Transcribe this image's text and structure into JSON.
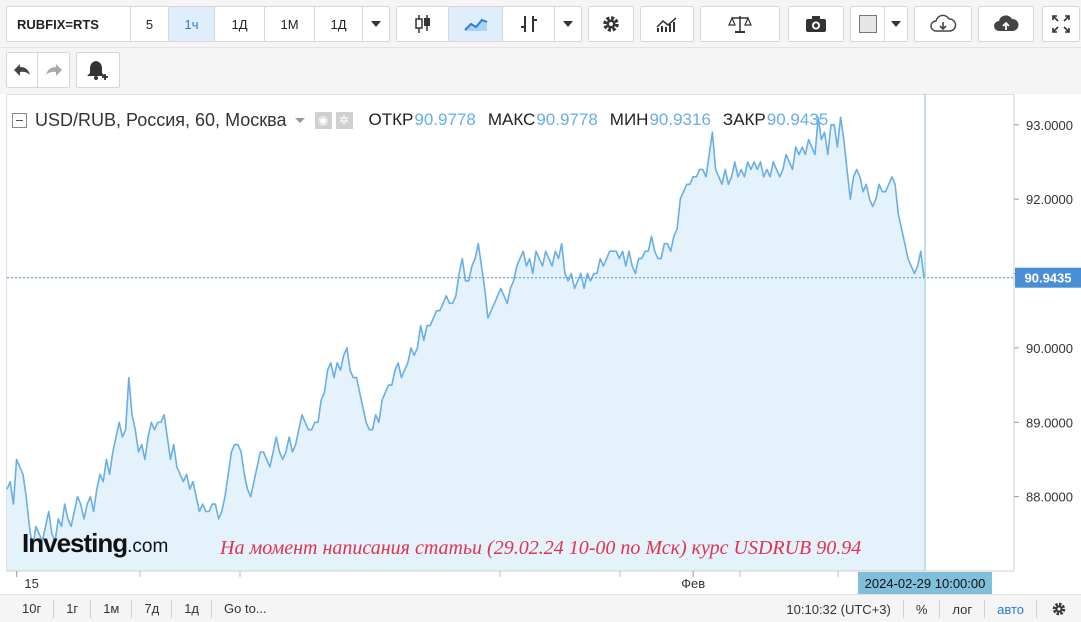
{
  "toolbar": {
    "symbol": "RUBFIX=RTS",
    "intervals": [
      "5",
      "1ч",
      "1Д",
      "1М",
      "1Д"
    ],
    "active_interval": 1
  },
  "legend": {
    "title": "USD/RUB, Россия, 60, Москва",
    "open_label": "ОТКР",
    "open_value": "90.9778",
    "high_label": "МАКС",
    "high_value": "90.9778",
    "low_label": "МИН",
    "low_value": "90.9316",
    "close_label": "ЗАКР",
    "close_value": "90.9435"
  },
  "logo": {
    "main": "Investing",
    "suffix": ".com"
  },
  "annotation": "На момент написания статьи (29.02.24 10-00 по Мск) курс USDRUB 90.94",
  "bottom": {
    "ranges": [
      "10г",
      "1г",
      "1м",
      "7д",
      "1д"
    ],
    "goto": "Go to...",
    "time": "10:10:32",
    "tz": "(UTC+3)",
    "percent": "%",
    "log": "лог",
    "auto": "авто"
  },
  "colors": {
    "line": "#6aaee6",
    "fill": "#e4f2fb",
    "price_tag": "#4a8fd6",
    "date_tag": "#7fbfd9",
    "annotation": "#e0334d"
  },
  "chart_data": {
    "type": "area",
    "title": "USD/RUB, Россия, 60, Москва",
    "xlabel": "",
    "ylabel": "",
    "ylim": [
      87.0,
      93.4
    ],
    "yticks": [
      88,
      89,
      90,
      91,
      92,
      93
    ],
    "ytick_labels": [
      "88.0000",
      "89.0000",
      "90.0000",
      "91.0000",
      "92.0000",
      "93.0000"
    ],
    "xtick_labels": [
      {
        "label": "15",
        "index": 3
      },
      {
        "label": "Фев",
        "index": 214
      }
    ],
    "last_value": 90.9435,
    "last_value_label": "90.9435",
    "last_date_label": "2024-02-29 10:00:00",
    "grid": false,
    "legend": "top-left",
    "series": [
      {
        "values": [
          88.1,
          88.2,
          87.9,
          88.5,
          88.4,
          88.3,
          88.0,
          87.6,
          87.3,
          87.6,
          87.5,
          87.4,
          87.6,
          87.8,
          87.5,
          87.4,
          87.7,
          87.6,
          87.9,
          87.7,
          87.6,
          87.8,
          88.0,
          87.9,
          87.7,
          87.9,
          88.0,
          87.8,
          88.1,
          88.3,
          88.2,
          88.5,
          88.3,
          88.6,
          88.8,
          89.0,
          88.8,
          88.9,
          89.6,
          89.1,
          88.9,
          88.6,
          88.7,
          88.5,
          88.8,
          89.0,
          88.9,
          89.0,
          89.0,
          89.1,
          88.8,
          88.5,
          88.7,
          88.4,
          88.3,
          88.2,
          88.3,
          88.1,
          88.2,
          88.0,
          87.8,
          87.9,
          87.8,
          87.8,
          87.9,
          87.9,
          87.7,
          87.8,
          88.0,
          88.3,
          88.6,
          88.7,
          88.7,
          88.6,
          88.3,
          88.1,
          88.0,
          88.2,
          88.4,
          88.6,
          88.6,
          88.5,
          88.4,
          88.6,
          88.8,
          88.6,
          88.5,
          88.6,
          88.8,
          88.6,
          88.7,
          88.9,
          89.1,
          89.0,
          88.9,
          88.9,
          89.0,
          89.0,
          89.3,
          89.4,
          89.7,
          89.8,
          89.6,
          89.8,
          89.7,
          89.9,
          90.0,
          89.7,
          89.6,
          89.6,
          89.4,
          89.2,
          89.0,
          88.9,
          88.9,
          89.1,
          89.0,
          89.3,
          89.4,
          89.5,
          89.5,
          89.7,
          89.8,
          89.6,
          89.7,
          89.8,
          90.0,
          89.9,
          90.0,
          90.3,
          90.1,
          90.3,
          90.3,
          90.4,
          90.5,
          90.5,
          90.6,
          90.7,
          90.6,
          90.6,
          90.7,
          91.0,
          91.2,
          90.9,
          90.9,
          91.1,
          91.2,
          91.4,
          91.1,
          90.8,
          90.4,
          90.5,
          90.6,
          90.7,
          90.8,
          90.7,
          90.6,
          90.8,
          90.9,
          91.1,
          91.2,
          91.3,
          91.1,
          91.2,
          91.0,
          91.3,
          91.2,
          91.1,
          91.3,
          91.2,
          91.1,
          91.3,
          91.2,
          91.4,
          91.0,
          90.9,
          91.0,
          90.8,
          90.9,
          91.0,
          90.8,
          91.0,
          90.9,
          91.0,
          91.0,
          91.2,
          91.1,
          91.2,
          91.3,
          91.3,
          91.3,
          91.2,
          91.3,
          91.1,
          91.3,
          91.1,
          91.0,
          91.2,
          91.2,
          91.3,
          91.3,
          91.5,
          91.3,
          91.2,
          91.2,
          91.4,
          91.4,
          91.3,
          91.5,
          91.6,
          92.0,
          92.1,
          92.2,
          92.2,
          92.3,
          92.3,
          92.4,
          92.4,
          92.3,
          92.6,
          92.9,
          92.4,
          92.3,
          92.2,
          92.4,
          92.2,
          92.3,
          92.5,
          92.3,
          92.4,
          92.3,
          92.5,
          92.4,
          92.5,
          92.4,
          92.5,
          92.3,
          92.4,
          92.3,
          92.5,
          92.4,
          92.3,
          92.4,
          92.6,
          92.5,
          92.4,
          92.7,
          92.6,
          92.7,
          92.6,
          92.8,
          92.7,
          92.6,
          93.1,
          92.8,
          92.9,
          92.6,
          93.0,
          93.0,
          92.7,
          93.1,
          92.8,
          92.4,
          92.0,
          92.3,
          92.4,
          92.3,
          92.1,
          92.2,
          92.0,
          91.9,
          92.0,
          92.2,
          92.1,
          92.1,
          92.2,
          92.3,
          92.2,
          91.8,
          91.6,
          91.4,
          91.2,
          91.1,
          91.0,
          91.1,
          91.3,
          90.9435
        ]
      }
    ]
  }
}
